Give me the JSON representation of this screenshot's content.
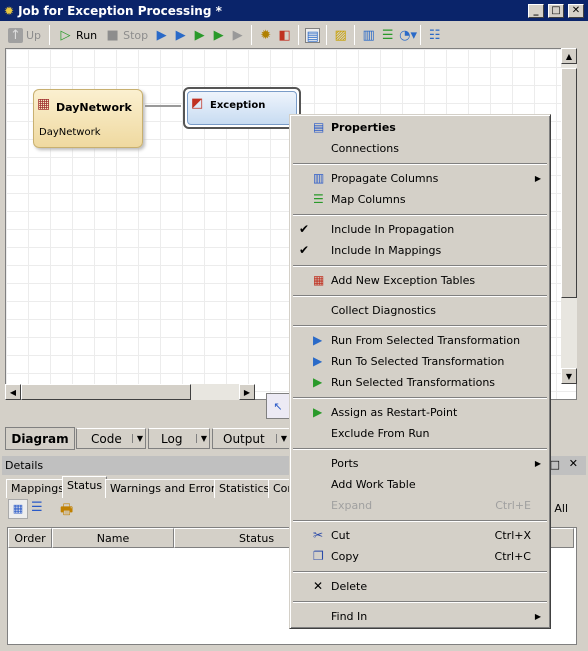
{
  "window": {
    "title": "Job for Exception Processing *"
  },
  "toolbar": {
    "up": "Up",
    "run": "Run",
    "stop": "Stop"
  },
  "diagram": {
    "nodes": [
      {
        "title": "DayNetwork",
        "subtitle": "DayNetwork"
      },
      {
        "title": "Exception"
      }
    ]
  },
  "bottom_tabs": [
    {
      "label": "Diagram"
    },
    {
      "label": "Code"
    },
    {
      "label": "Log"
    },
    {
      "label": "Output"
    }
  ],
  "details": {
    "title": "Details",
    "tabs": [
      "Mappings",
      "Status",
      "Warnings and Errors",
      "Statistics",
      "Cor"
    ],
    "clear_all": "r All",
    "columns": [
      "Order",
      "Name",
      "Status"
    ]
  },
  "context_menu": {
    "items": [
      {
        "label": "Properties",
        "icon": "properties-icon",
        "bold": true
      },
      {
        "label": "Connections"
      },
      {
        "sep": true
      },
      {
        "label": "Propagate Columns",
        "icon": "propagate-columns-icon",
        "submenu": true
      },
      {
        "label": "Map Columns",
        "icon": "map-columns-icon"
      },
      {
        "sep": true
      },
      {
        "label": "Include In Propagation",
        "checked": true
      },
      {
        "label": "Include In Mappings",
        "checked": true
      },
      {
        "sep": true
      },
      {
        "label": "Add New Exception Tables",
        "icon": "exception-table-icon"
      },
      {
        "sep": true
      },
      {
        "label": "Collect Diagnostics"
      },
      {
        "sep": true
      },
      {
        "label": "Run From Selected Transformation",
        "icon": "run-from-icon"
      },
      {
        "label": "Run To Selected Transformation",
        "icon": "run-to-icon"
      },
      {
        "label": "Run Selected Transformations",
        "icon": "run-selected-icon"
      },
      {
        "sep": true
      },
      {
        "label": "Assign as Restart-Point",
        "icon": "restart-point-icon"
      },
      {
        "label": "Exclude From Run"
      },
      {
        "sep": true
      },
      {
        "label": "Ports",
        "submenu": true
      },
      {
        "label": "Add Work Table"
      },
      {
        "label": "Expand",
        "shortcut": "Ctrl+E",
        "disabled": true
      },
      {
        "sep": true
      },
      {
        "label": "Cut",
        "shortcut": "Ctrl+X",
        "icon": "scissors-icon"
      },
      {
        "label": "Copy",
        "shortcut": "Ctrl+C",
        "icon": "copy-icon"
      },
      {
        "sep": true
      },
      {
        "label": "Delete",
        "icon": "delete-icon"
      },
      {
        "sep": true
      },
      {
        "label": "Find In",
        "submenu": true
      }
    ]
  }
}
